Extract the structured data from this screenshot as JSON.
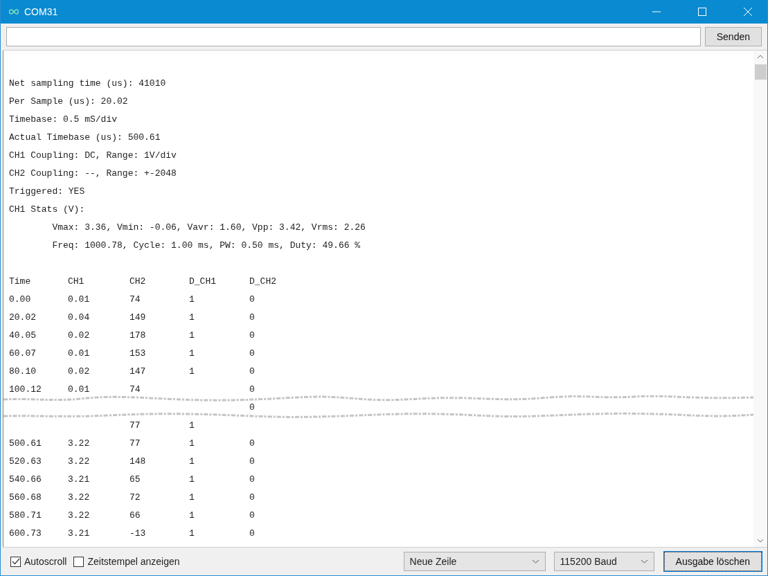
{
  "window": {
    "title": "COM31"
  },
  "send_button": "Senden",
  "log_lines": [
    "Net sampling time (us): 41010",
    "Per Sample (us): 20.02",
    "Timebase: 0.5 mS/div",
    "Actual Timebase (us): 500.61",
    "CH1 Coupling: DC, Range: 1V/div",
    "CH2 Coupling: --, Range: +-2048",
    "Triggered: YES",
    "CH1 Stats (V):",
    "        Vmax: 3.36, Vmin: -0.06, Vavr: 1.60, Vpp: 3.42, Vrms: 2.26",
    "        Freq: 1000.78, Cycle: 1.00 ms, PW: 0.50 ms, Duty: 49.66 %"
  ],
  "table": {
    "columns": [
      "Time",
      "CH1",
      "CH2",
      "D_CH1",
      "D_CH2"
    ],
    "rows": [
      {
        "cells": [
          "0.00",
          "0.01",
          "74",
          "1",
          "0"
        ]
      },
      {
        "cells": [
          "20.02",
          "0.04",
          "149",
          "1",
          "0"
        ]
      },
      {
        "cells": [
          "40.05",
          "0.02",
          "178",
          "1",
          "0"
        ]
      },
      {
        "cells": [
          "60.07",
          "0.01",
          "153",
          "1",
          "0"
        ]
      },
      {
        "cells": [
          "80.10",
          "0.02",
          "147",
          "1",
          "0"
        ]
      },
      {
        "cells": [
          "100.12",
          "0.01",
          "74",
          null,
          "0"
        ]
      },
      {
        "cells": [
          null,
          null,
          null,
          null,
          "0"
        ]
      },
      {
        "cells": [
          null,
          null,
          "77",
          "1",
          null
        ]
      },
      {
        "cells": [
          "500.61",
          "3.22",
          "77",
          "1",
          "0"
        ]
      },
      {
        "cells": [
          "520.63",
          "3.22",
          "148",
          "1",
          "0"
        ]
      },
      {
        "cells": [
          "540.66",
          "3.21",
          "65",
          "1",
          "0"
        ]
      },
      {
        "cells": [
          "560.68",
          "3.22",
          "72",
          "1",
          "0"
        ]
      },
      {
        "cells": [
          "580.71",
          "3.22",
          "66",
          "1",
          "0"
        ]
      },
      {
        "cells": [
          "600.73",
          "3.21",
          "-13",
          "1",
          "0"
        ]
      }
    ]
  },
  "footer": {
    "checkboxes": [
      {
        "label": "Autoscroll",
        "checked": true
      },
      {
        "label": "Zeitstempel anzeigen",
        "checked": false
      }
    ],
    "line_ending": "Neue Zeile",
    "baud_rate": "115200 Baud",
    "clear_button": "Ausgabe löschen"
  }
}
